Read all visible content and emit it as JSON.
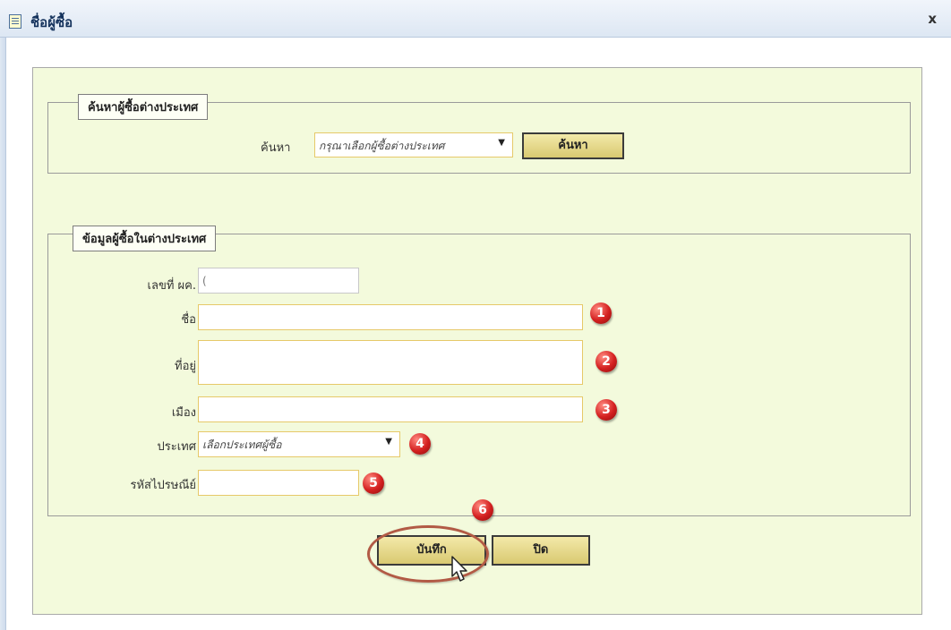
{
  "window": {
    "title": "ชื่อผู้ซื้อ",
    "close_label": "x"
  },
  "search_group": {
    "legend": "ค้นหาผู้ซื้อต่างประเทศ",
    "search_label": "ค้นหา",
    "select_value": "กรุณาเลือกผู้ซื้อต่างประเทศ",
    "search_button": "ค้นหา"
  },
  "info_group": {
    "legend": "ข้อมูลผู้ซื้อในต่างประเทศ",
    "fields": {
      "id": {
        "label": "เลขที่ ผค.",
        "value": "("
      },
      "name": {
        "label": "ชื่อ",
        "value": ""
      },
      "address": {
        "label": "ที่อยู่",
        "value": ""
      },
      "city": {
        "label": "เมือง",
        "value": ""
      },
      "country": {
        "label": "ประเทศ",
        "value": "เลือกประเทศผู้ซื้อ"
      },
      "postcode": {
        "label": "รหัสไปรษณีย์",
        "value": ""
      }
    }
  },
  "buttons": {
    "save": "บันทึก",
    "close": "ปิด"
  },
  "annotations": [
    "1",
    "2",
    "3",
    "4",
    "5",
    "6"
  ]
}
